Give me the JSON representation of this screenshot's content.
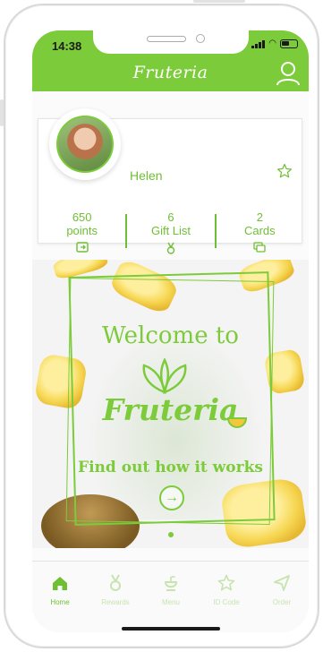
{
  "status_bar": {
    "time": "14:38"
  },
  "header": {
    "brand": "Fruteria"
  },
  "profile": {
    "name": "Helen",
    "stats": [
      {
        "value": "650",
        "label": "points",
        "icon": "points-icon"
      },
      {
        "value": "6",
        "label": "Gift List",
        "icon": "medal-icon"
      },
      {
        "value": "2",
        "label": "Cards",
        "icon": "cards-icon"
      }
    ]
  },
  "banner": {
    "welcome": "Welcome to",
    "brand": "Fruteria",
    "tagline": "Find out how it works"
  },
  "tabs": [
    {
      "label": "Home",
      "icon": "home-icon",
      "active": true
    },
    {
      "label": "Rewards",
      "icon": "medal-icon",
      "active": false
    },
    {
      "label": "Menu",
      "icon": "menu-icon",
      "active": false
    },
    {
      "label": "ID Code",
      "icon": "star-icon",
      "active": false
    },
    {
      "label": "Order",
      "icon": "send-icon",
      "active": false
    }
  ],
  "colors": {
    "accent": "#7ccb3a",
    "inactive_tab": "#c7e4b0"
  }
}
